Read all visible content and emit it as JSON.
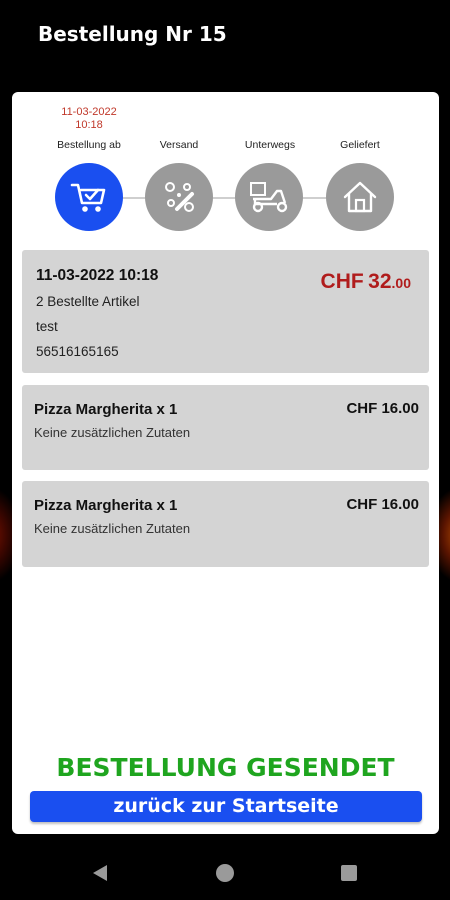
{
  "header": {
    "title": "Bestellung Nr 15"
  },
  "progress": {
    "steps": [
      {
        "label": "Bestellung ab",
        "date": "11-03-2022",
        "time": "10:18",
        "active": true,
        "icon": "cart-check-icon"
      },
      {
        "label": "Versand",
        "active": false,
        "icon": "pizza-cutter-icon"
      },
      {
        "label": "Unterwegs",
        "active": false,
        "icon": "delivery-scooter-icon"
      },
      {
        "label": "Geliefert",
        "active": false,
        "icon": "home-icon"
      }
    ]
  },
  "summary": {
    "datetime": "11-03-2022 10:18",
    "item_count_text": "2 Bestellte Artikel",
    "customer_name": "test",
    "phone": "56516165165",
    "total_currency": "CHF",
    "total_int": "32",
    "total_dec": ".00"
  },
  "items": [
    {
      "name": "Pizza Margherita x 1",
      "price": "CHF 16.00",
      "extras": "Keine zusätzlichen Zutaten"
    },
    {
      "name": "Pizza Margherita x 1",
      "price": "CHF 16.00",
      "extras": "Keine zusätzlichen Zutaten"
    }
  ],
  "status_text": "BESTELLUNG GESENDET",
  "home_button_label": "zurück zur Startseite",
  "colors": {
    "accent": "#1a4ff0",
    "success": "#1fa51f",
    "price": "#b01c1c",
    "inactive": "#9a9a9a"
  },
  "system_nav": {
    "back": "back-icon",
    "home": "home-circle-icon",
    "recent": "recents-icon"
  }
}
